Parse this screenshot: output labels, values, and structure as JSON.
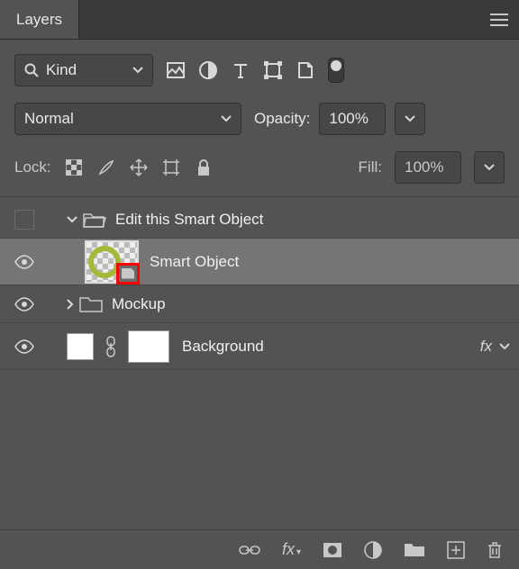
{
  "tab": {
    "title": "Layers"
  },
  "filter": {
    "kind_label": "Kind"
  },
  "blend": {
    "mode": "Normal",
    "opacity_label": "Opacity:",
    "opacity_value": "100%"
  },
  "lock": {
    "label": "Lock:",
    "fill_label": "Fill:",
    "fill_value": "100%"
  },
  "layers": {
    "group1": {
      "name": "Edit this Smart Object"
    },
    "smart": {
      "name": "Smart Object"
    },
    "group2": {
      "name": "Mockup"
    },
    "bg": {
      "name": "Background",
      "fx": "fx"
    }
  }
}
